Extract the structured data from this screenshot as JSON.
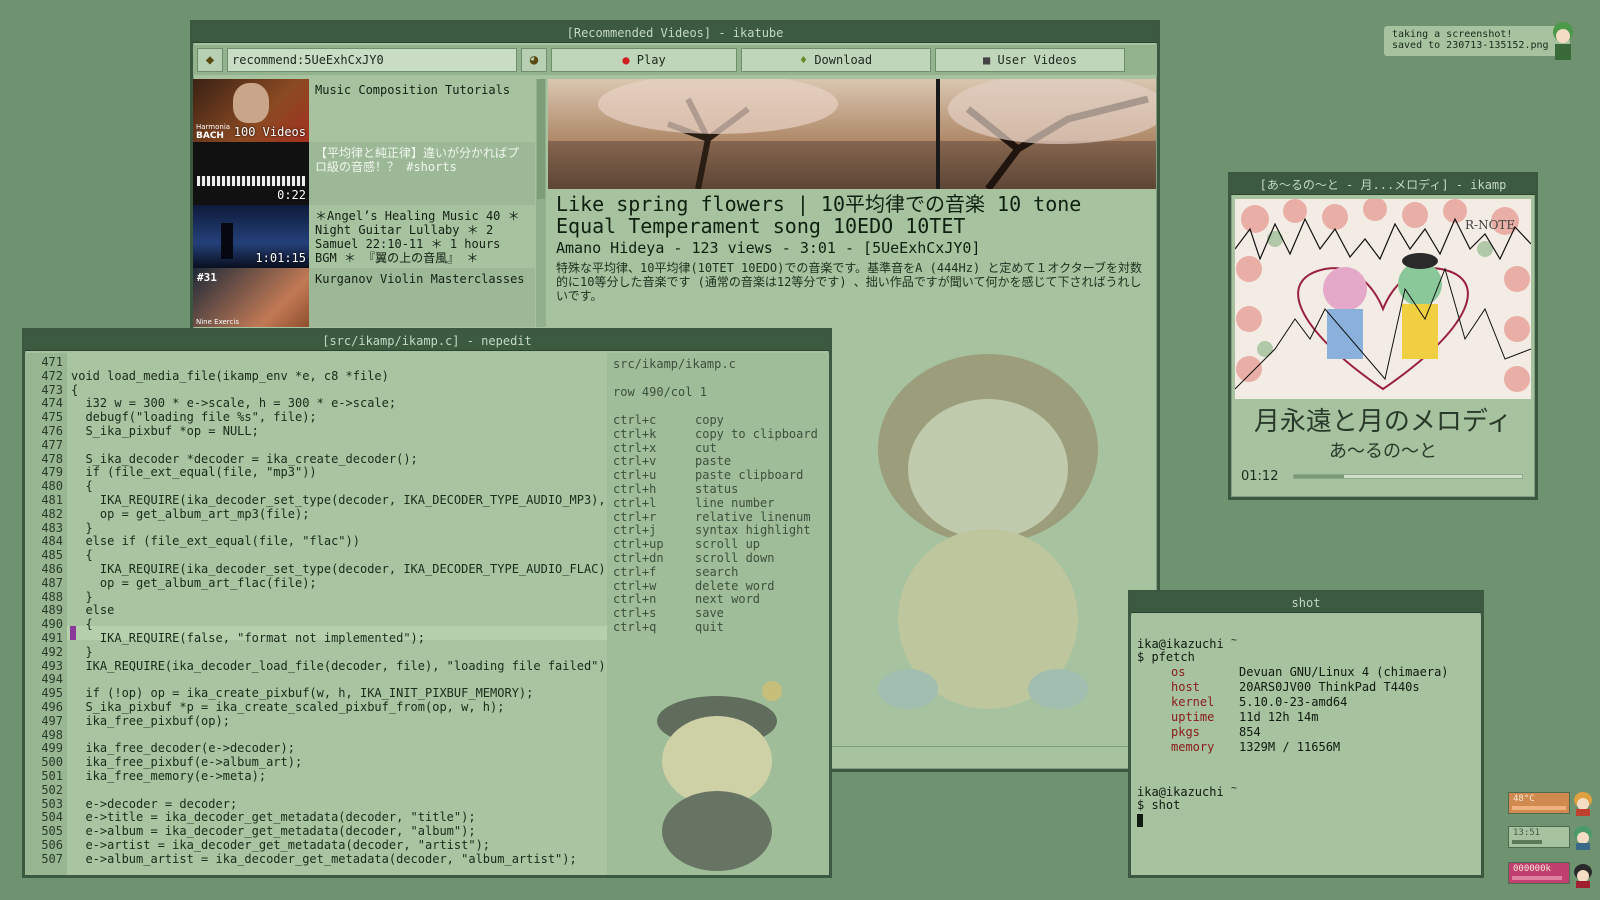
{
  "colors": {
    "desktop": "#6f9270",
    "window_bg": "#a6c29f",
    "titlebar": "#3b5a40",
    "accent_red": "#8b1a1a"
  },
  "ikatube": {
    "title": "[Recommended Videos] - ikatube",
    "search_value": "recommend:5UeExhCxJY0",
    "play_label": "Play",
    "download_label": "Download",
    "user_videos_label": "User Videos",
    "videos": [
      {
        "title": "Music Composition Tutorials",
        "duration": "100 Videos"
      },
      {
        "title": "【平均律と純正律】違いが分かればプロ級の音感！？ #shorts",
        "duration": "0:22"
      },
      {
        "title": "＊Angel’s Healing Music 40 ＊ Night Guitar Lullaby ＊ 2 Samuel 22:10-11 ＊ 1 hours BGM ＊ 『翼の上の音風』 ＊",
        "duration": "1:01:15"
      },
      {
        "title": "Kurganov Violin Masterclasses",
        "duration": "#31"
      }
    ],
    "thumb_labels": {
      "bach": "BACH",
      "harmonia": "Harmonia",
      "nine": "Nine Exercis"
    },
    "selected": {
      "title": "Like spring flowers | 10平均律での音楽 10 tone Equal Temperament song 10EDO 10TET",
      "meta": "Amano Hideya - 123 views - 3:01 - [5UeExhCxJY0]",
      "description": "特殊な平均律、10平均律(10TET 10EDO)での音楽です。基準音をA (444Hz) と定めて１オクターブを対数的に10等分した音楽です (通常の音楽は12等分です) 、拙い作品ですが聞いて何かを感じて下さればうれしいです。"
    }
  },
  "nepedit": {
    "title": "[src/ikamp/ikamp.c] - nepedit",
    "file": "src/ikamp/ikamp.c",
    "position": "row 490/col 1",
    "lines": [
      {
        "n": "471",
        "code": ""
      },
      {
        "n": "472",
        "code": "void load_media_file(ikamp_env *e, c8 *file)"
      },
      {
        "n": "473",
        "code": "{"
      },
      {
        "n": "474",
        "code": "  i32 w = 300 * e->scale, h = 300 * e->scale;"
      },
      {
        "n": "475",
        "code": "  debugf(\"loading file %s\", file);"
      },
      {
        "n": "476",
        "code": "  S_ika_pixbuf *op = NULL;"
      },
      {
        "n": "477",
        "code": ""
      },
      {
        "n": "478",
        "code": "  S_ika_decoder *decoder = ika_create_decoder();"
      },
      {
        "n": "479",
        "code": "  if (file_ext_equal(file, \"mp3\"))"
      },
      {
        "n": "480",
        "code": "  {"
      },
      {
        "n": "481",
        "code": "    IKA_REQUIRE(ika_decoder_set_type(decoder, IKA_DECODER_TYPE_AUDIO_MP3), \"mp3 decoding failed\");"
      },
      {
        "n": "482",
        "code": "    op = get_album_art_mp3(file);"
      },
      {
        "n": "483",
        "code": "  }"
      },
      {
        "n": "484",
        "code": "  else if (file_ext_equal(file, \"flac\"))"
      },
      {
        "n": "485",
        "code": "  {"
      },
      {
        "n": "486",
        "code": "    IKA_REQUIRE(ika_decoder_set_type(decoder, IKA_DECODER_TYPE_AUDIO_FLAC), \"flac decoding failed\");"
      },
      {
        "n": "487",
        "code": "    op = get_album_art_flac(file);"
      },
      {
        "n": "488",
        "code": "  }"
      },
      {
        "n": "489",
        "code": "  else"
      },
      {
        "n": "490",
        "code": "  {"
      },
      {
        "n": "491",
        "code": "    IKA_REQUIRE(false, \"format not implemented\");"
      },
      {
        "n": "492",
        "code": "  }"
      },
      {
        "n": "493",
        "code": "  IKA_REQUIRE(ika_decoder_load_file(decoder, file), \"loading file failed\");"
      },
      {
        "n": "494",
        "code": ""
      },
      {
        "n": "495",
        "code": "  if (!op) op = ika_create_pixbuf(w, h, IKA_INIT_PIXBUF_MEMORY);"
      },
      {
        "n": "496",
        "code": "  S_ika_pixbuf *p = ika_create_scaled_pixbuf_from(op, w, h);"
      },
      {
        "n": "497",
        "code": "  ika_free_pixbuf(op);"
      },
      {
        "n": "498",
        "code": ""
      },
      {
        "n": "499",
        "code": "  ika_free_decoder(e->decoder);"
      },
      {
        "n": "500",
        "code": "  ika_free_pixbuf(e->album_art);"
      },
      {
        "n": "501",
        "code": "  ika_free_memory(e->meta);"
      },
      {
        "n": "502",
        "code": ""
      },
      {
        "n": "503",
        "code": "  e->decoder = decoder;"
      },
      {
        "n": "504",
        "code": "  e->title = ika_decoder_get_metadata(decoder, \"title\");"
      },
      {
        "n": "505",
        "code": "  e->album = ika_decoder_get_metadata(decoder, \"album\");"
      },
      {
        "n": "506",
        "code": "  e->artist = ika_decoder_get_metadata(decoder, \"artist\");"
      },
      {
        "n": "507",
        "code": "  e->album_artist = ika_decoder_get_metadata(decoder, \"album_artist\");"
      }
    ],
    "shortcuts": [
      {
        "key": "ctrl+c",
        "desc": "copy"
      },
      {
        "key": "ctrl+k",
        "desc": "copy to clipboard"
      },
      {
        "key": "ctrl+x",
        "desc": "cut"
      },
      {
        "key": "ctrl+v",
        "desc": "paste"
      },
      {
        "key": "ctrl+u",
        "desc": "paste clipboard"
      },
      {
        "key": "ctrl+h",
        "desc": "status"
      },
      {
        "key": "ctrl+l",
        "desc": "line number"
      },
      {
        "key": "ctrl+r",
        "desc": "relative linenum"
      },
      {
        "key": "ctrl+j",
        "desc": "syntax highlight"
      },
      {
        "key": "ctrl+up",
        "desc": "scroll up"
      },
      {
        "key": "ctrl+dn",
        "desc": "scroll down"
      },
      {
        "key": "ctrl+f",
        "desc": "search"
      },
      {
        "key": "ctrl+w",
        "desc": "delete word"
      },
      {
        "key": "ctrl+n",
        "desc": "next word"
      },
      {
        "key": "ctrl+s",
        "desc": "save"
      },
      {
        "key": "ctrl+q",
        "desc": "quit"
      }
    ]
  },
  "ikamp": {
    "title": "[あ～るの～と - 月...メロディ] - ikamp",
    "song": "月永遠と月のメロディ",
    "artist": "あ～るの～と",
    "time": "01:12",
    "progress": 0.22,
    "art_label": "R-NOTE"
  },
  "shot": {
    "title": "shot",
    "prompt1": "ika@ikazuchi",
    "tilde": "~",
    "cmd1": "$ pfetch",
    "info": [
      {
        "key": "os",
        "value": "Devuan GNU/Linux 4 (chimaera)"
      },
      {
        "key": "host",
        "value": "20ARS0JV00 ThinkPad T440s"
      },
      {
        "key": "kernel",
        "value": "5.10.0-23-amd64"
      },
      {
        "key": "uptime",
        "value": "11d 12h 14m"
      },
      {
        "key": "pkgs",
        "value": "854"
      },
      {
        "key": "memory",
        "value": "1329M / 11656M"
      }
    ],
    "prompt2": "ika@ikazuchi",
    "cmd2": "$ shot"
  },
  "notification": {
    "line1": "taking a screenshot!",
    "line2": "saved to 230713-135152.png"
  },
  "status": {
    "temp": "48°C",
    "clock": "13:51",
    "net": "000000k"
  }
}
